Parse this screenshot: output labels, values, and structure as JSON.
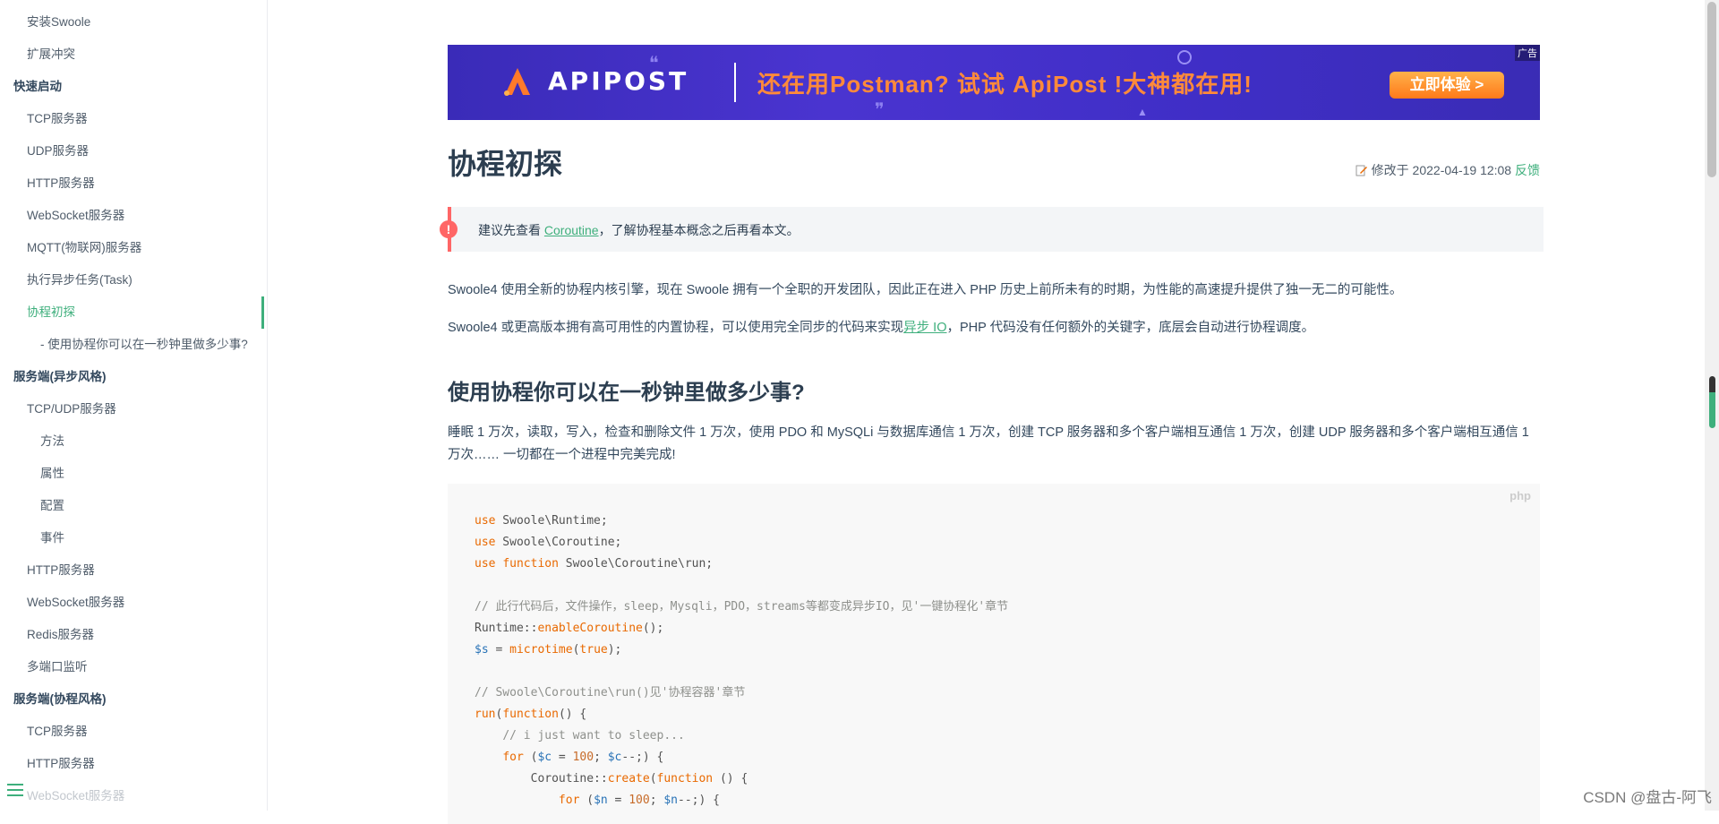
{
  "sidebar": {
    "items": [
      {
        "label": "安装Swoole",
        "level": 1
      },
      {
        "label": "扩展冲突",
        "level": 1
      },
      {
        "label": "快速启动",
        "level": 0
      },
      {
        "label": "TCP服务器",
        "level": 1
      },
      {
        "label": "UDP服务器",
        "level": 1
      },
      {
        "label": "HTTP服务器",
        "level": 1
      },
      {
        "label": "WebSocket服务器",
        "level": 1
      },
      {
        "label": "MQTT(物联网)服务器",
        "level": 1
      },
      {
        "label": "执行异步任务(Task)",
        "level": 1
      },
      {
        "label": "协程初探",
        "level": 1,
        "active": true
      },
      {
        "label": "- 使用协程你可以在一秒钟里做多少事?",
        "level": 2
      },
      {
        "label": "服务端(异步风格)",
        "level": 0
      },
      {
        "label": "TCP/UDP服务器",
        "level": 1
      },
      {
        "label": "方法",
        "level": 2
      },
      {
        "label": "属性",
        "level": 2
      },
      {
        "label": "配置",
        "level": 2
      },
      {
        "label": "事件",
        "level": 2
      },
      {
        "label": "HTTP服务器",
        "level": 1
      },
      {
        "label": "WebSocket服务器",
        "level": 1
      },
      {
        "label": "Redis服务器",
        "level": 1
      },
      {
        "label": "多端口监听",
        "level": 1
      },
      {
        "label": "服务端(协程风格)",
        "level": 0
      },
      {
        "label": "TCP服务器",
        "level": 1
      },
      {
        "label": "HTTP服务器",
        "level": 1
      },
      {
        "label": "WebSocket服务器",
        "level": 1,
        "faded": true
      }
    ],
    "menu_icon": "hamburger-menu-icon"
  },
  "ad": {
    "logo": "APIPOST",
    "slogan": "还在用Postman? 试试 ApiPost !大神都在用!",
    "cta": "立即体验 >",
    "tag": "广告"
  },
  "article": {
    "title": "协程初探",
    "meta_prefix": "修改于 2022-04-19 12:08",
    "feedback_link": "反馈",
    "tip": {
      "before": "建议先查看 ",
      "link": "Coroutine",
      "after": "，了解协程基本概念之后再看本文。",
      "icon": "!"
    },
    "para1": "Swoole4 使用全新的协程内核引擎，现在 Swoole 拥有一个全职的开发团队，因此正在进入 PHP 历史上前所未有的时期，为性能的高速提升提供了独一无二的可能性。",
    "para2_before": "Swoole4 或更高版本拥有高可用性的内置协程，可以使用完全同步的代码来实现",
    "para2_link": "异步 IO",
    "para2_after": "，PHP 代码没有任何额外的关键字，底层会自动进行协程调度。",
    "h2": "使用协程你可以在一秒钟里做多少事?",
    "para3": "睡眠 1 万次，读取，写入，检查和删除文件 1 万次，使用 PDO 和 MySQLi 与数据库通信 1 万次，创建 TCP 服务器和多个客户端相互通信 1 万次，创建 UDP 服务器和多个客户端相互通信 1 万次…… 一切都在一个进程中完美完成!",
    "code_lang": "php"
  },
  "watermark": "CSDN @盘古-阿飞",
  "colors": {
    "accent": "#3eaf7c",
    "tip_border": "#ff6666",
    "ad_bg": "#4232c8",
    "ad_slogan": "#ff8a3a"
  }
}
